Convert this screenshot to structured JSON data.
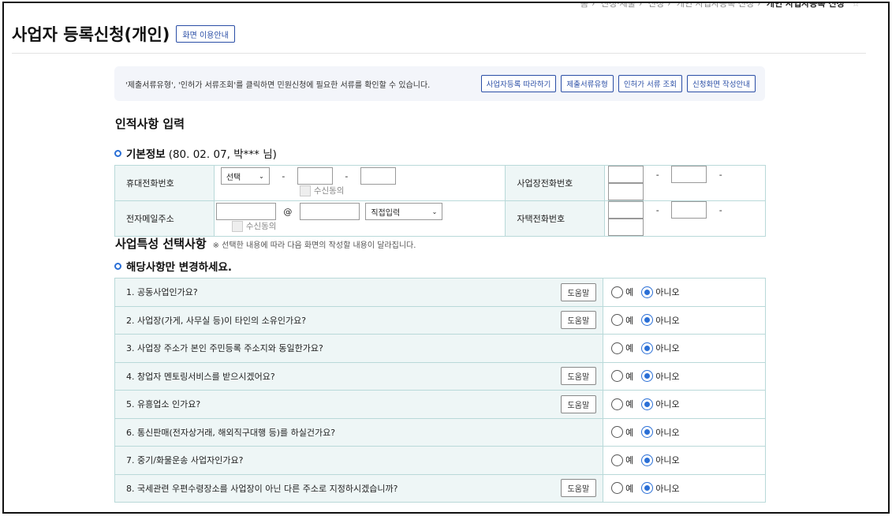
{
  "breadcrumb": [
    "홈",
    "신청·제출",
    "신청",
    "개인 사업자등록 신청",
    "개인 사업자등록 신청"
  ],
  "page_title": "사업자 등록신청(개인)",
  "guide_button": "화면 이용안내",
  "info": {
    "text": "'제출서류유형', '인허가 서류조회'를 클릭하면 민원신청에 필요한 서류를 확인할 수 있습니다.",
    "buttons": [
      "사업자등록 따라하기",
      "제출서류유형",
      "인허가 서류 조회",
      "신청화면 작성안내"
    ]
  },
  "personal_section": {
    "title": "인적사항 입력",
    "basic_label": "기본정보",
    "basic_detail": "(80. 02. 07, 박*** 님)",
    "rows": {
      "mobile_label": "휴대전화번호",
      "mobile_select": "선택",
      "consent_label": "수신동의",
      "biz_phone_label": "사업장전화번호",
      "email_label": "전자메일주소",
      "email_at": "@",
      "email_domain_select": "직접입력",
      "home_phone_label": "자택전화번호"
    },
    "dash": "-"
  },
  "business_section": {
    "title": "사업특성 선택사항",
    "note": "※ 선택한 내용에 따라 다음 화면의 작성할 내용이 달라집니다.",
    "subtitle": "해당사항만 변경하세요.",
    "help_label": "도움말",
    "yes_label": "예",
    "no_label": "아니오",
    "questions": [
      {
        "text": "1. 공동사업인가요?",
        "help": true,
        "answer": "no"
      },
      {
        "text": "2. 사업장(가게, 사무실 등)이 타인의 소유인가요?",
        "help": true,
        "answer": "no"
      },
      {
        "text": "3. 사업장 주소가 본인 주민등록 주소지와 동일한가요?",
        "help": false,
        "answer": "no"
      },
      {
        "text": "4. 창업자 멘토링서비스를 받으시겠어요?",
        "help": true,
        "answer": "no"
      },
      {
        "text": "5. 유흥업소 인가요?",
        "help": true,
        "answer": "no"
      },
      {
        "text": "6. 통신판매(전자상거래, 해외직구대행 등)를 하실건가요?",
        "help": false,
        "answer": "no"
      },
      {
        "text": "7. 중기/화물운송 사업자인가요?",
        "help": false,
        "answer": "no"
      },
      {
        "text": "8. 국세관련 우편수령장소를 사업장이 아닌 다른 주소로 지정하시겠습니까?",
        "help": true,
        "answer": "no"
      }
    ]
  }
}
